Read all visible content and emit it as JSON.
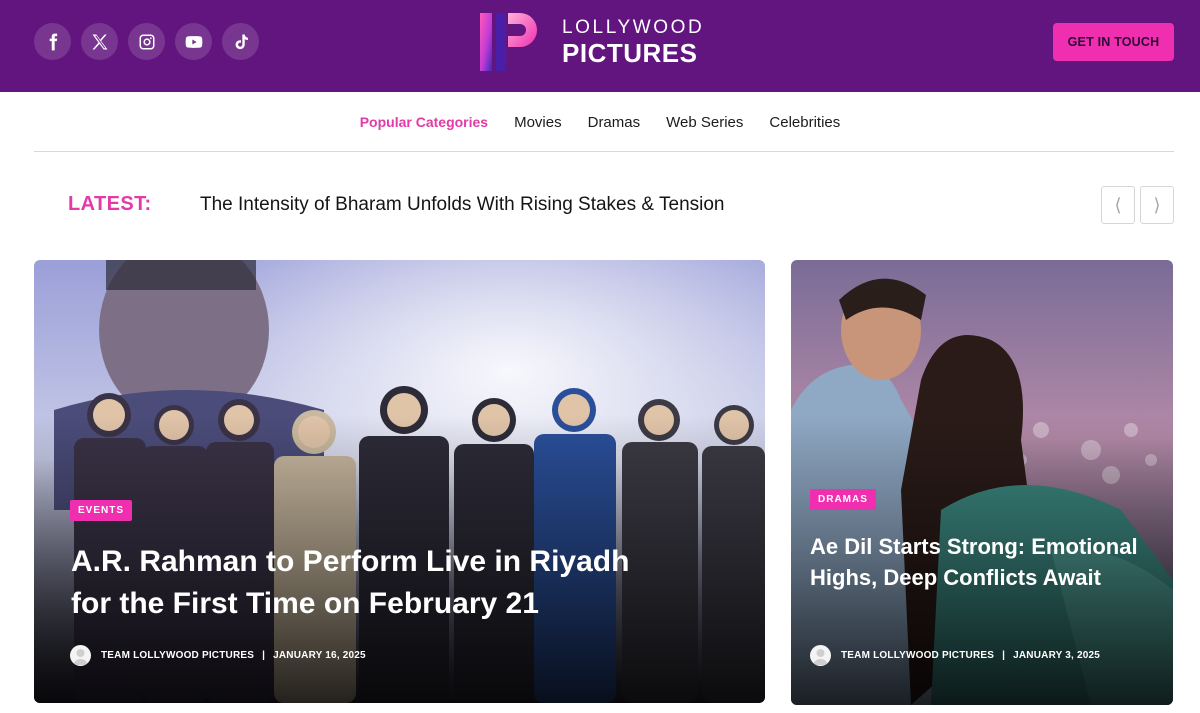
{
  "header": {
    "socials": [
      {
        "icon": "facebook-icon"
      },
      {
        "icon": "x-icon"
      },
      {
        "icon": "instagram-icon"
      },
      {
        "icon": "youtube-icon"
      },
      {
        "icon": "tiktok-icon"
      }
    ],
    "logo_line1": "LOLLYWOOD",
    "logo_line2": "PICTURES",
    "cta_label": "GET IN TOUCH",
    "background_color": "#62157e",
    "accent_color": "#f02fb0"
  },
  "nav": {
    "items": [
      {
        "label": "Popular Categories",
        "active": true
      },
      {
        "label": "Movies"
      },
      {
        "label": "Dramas"
      },
      {
        "label": "Web Series"
      },
      {
        "label": "Celebrities"
      }
    ]
  },
  "ticker": {
    "label": "LATEST:",
    "headline": "The Intensity of Bharam Unfolds With Rising Stakes & Tension",
    "prev_icon": "chevron-left-icon",
    "next_icon": "chevron-right-icon"
  },
  "featured": [
    {
      "category": "EVENTS",
      "title": "A.R. Rahman to Perform Live in Riyadh for the First Time on February 21",
      "author": "TEAM LOLLYWOOD PICTURES",
      "date": "JANUARY 16, 2025"
    },
    {
      "category": "DRAMAS",
      "title": "Ae Dil Starts Strong: Emotional Highs, Deep Conflicts Await",
      "author": "TEAM LOLLYWOOD PICTURES",
      "date": "JANUARY 3, 2025"
    }
  ]
}
